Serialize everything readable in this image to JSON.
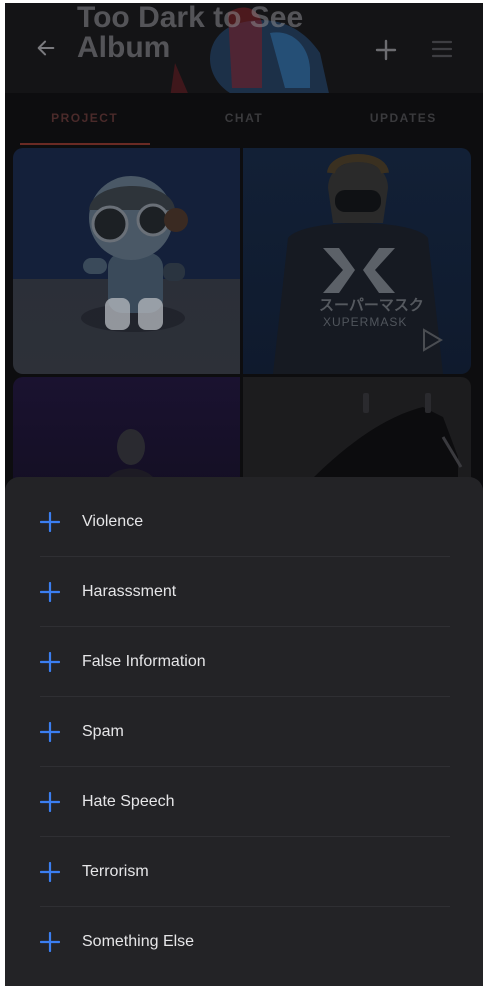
{
  "header": {
    "title": "Too Dark to See Album",
    "back_icon": "back-arrow-icon",
    "add_icon": "plus-icon",
    "menu_icon": "hamburger-menu-icon"
  },
  "tabs": [
    {
      "label": "PROJECT",
      "active": true
    },
    {
      "label": "CHAT",
      "active": false
    },
    {
      "label": "UPDATES",
      "active": false
    }
  ],
  "grid": {
    "tile2_text_jp": "スーパーマスク",
    "tile2_text_en": "XUPERMASK",
    "tile2_video_icon": "play-icon"
  },
  "report_options": [
    {
      "label": "Violence"
    },
    {
      "label": "Harasssment"
    },
    {
      "label": "False Information"
    },
    {
      "label": "Spam"
    },
    {
      "label": "Hate Speech"
    },
    {
      "label": "Terrorism"
    },
    {
      "label": "Something Else"
    }
  ],
  "colors": {
    "accent": "#3b7ef0",
    "sheet_bg": "#232326",
    "tab_underline": "#6a2a24"
  }
}
